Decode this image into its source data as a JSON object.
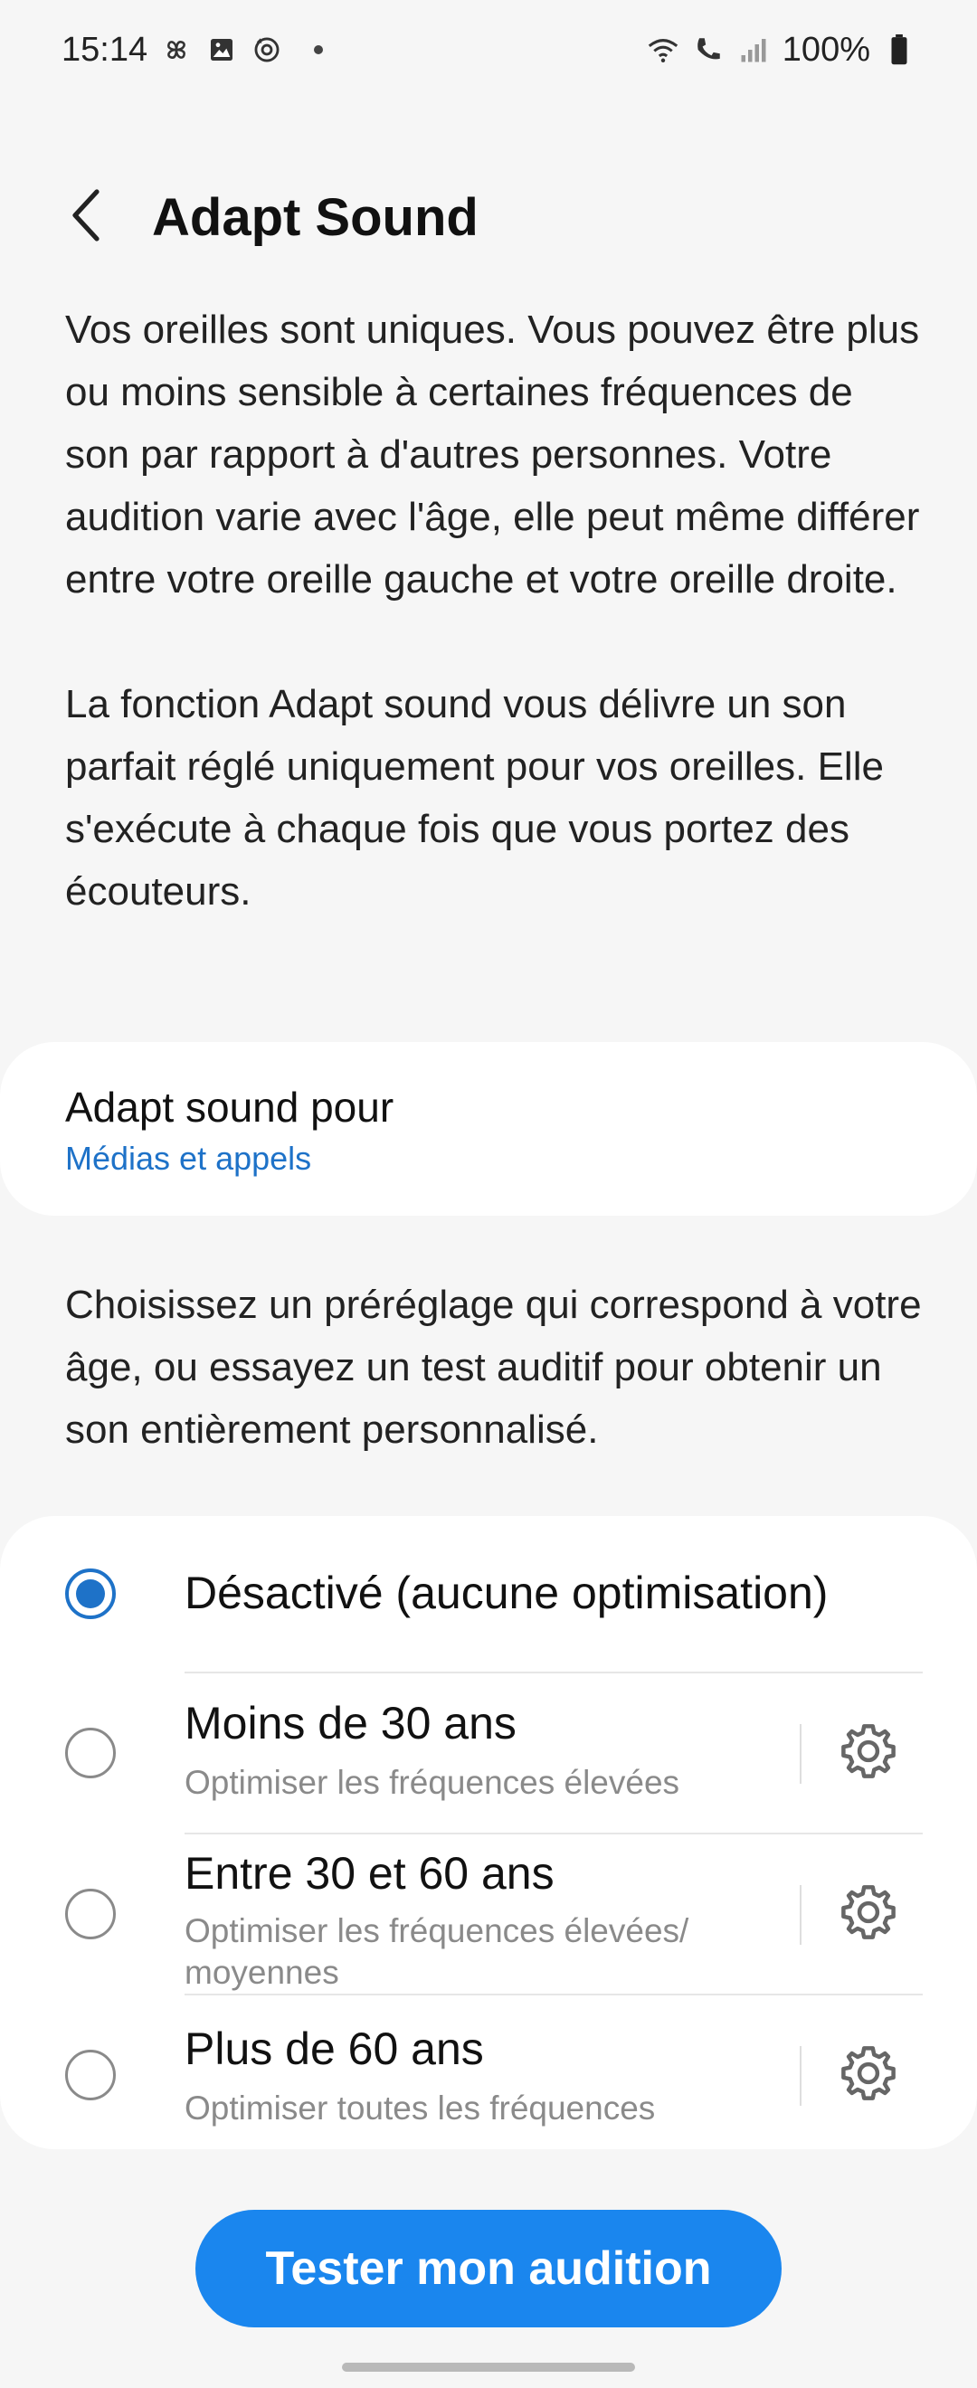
{
  "status_bar": {
    "time": "15:14",
    "battery": "100%",
    "left_icons": [
      "pinwheel-icon",
      "image-icon",
      "sync-target-icon"
    ],
    "right_icons": [
      "wifi-icon",
      "wifi-call-icon",
      "signal-icon",
      "battery-icon"
    ]
  },
  "header": {
    "title": "Adapt Sound",
    "back_icon": "chevron-left-icon"
  },
  "intro": {
    "paragraph1": "Vos oreilles sont uniques. Vous pouvez être plus ou moins sensible à certaines fréquences de son par rapport à d'autres personnes. Votre audition varie avec l'âge, elle peut même différer entre votre oreille gauche et votre oreille droite.",
    "paragraph2": "La fonction Adapt sound vous délivre un son parfait réglé uniquement pour vos oreilles. Elle s'exécute à chaque fois que vous portez des écouteurs."
  },
  "adapt_for": {
    "title": "Adapt sound pour",
    "value": "Médias et appels"
  },
  "choose_text": "Choisissez un préréglage qui correspond à votre âge, ou essayez un test auditif pour obtenir un son entièrement personnalisé.",
  "options": [
    {
      "title": "Désactivé (aucune optimisation)",
      "subtitle": "",
      "selected": true
    },
    {
      "title": "Moins de 30 ans",
      "subtitle": "Optimiser les fréquences élevées",
      "selected": false
    },
    {
      "title": "Entre 30 et 60 ans",
      "subtitle": "Optimiser les fréquences élevées/ moyennes",
      "selected": false
    },
    {
      "title": "Plus de 60 ans",
      "subtitle": "Optimiser toutes les fréquences",
      "selected": false
    }
  ],
  "test_button": "Tester mon audition",
  "colors": {
    "accent": "#1e72c8",
    "button": "#1a86ee",
    "background": "#f6f6f6"
  }
}
